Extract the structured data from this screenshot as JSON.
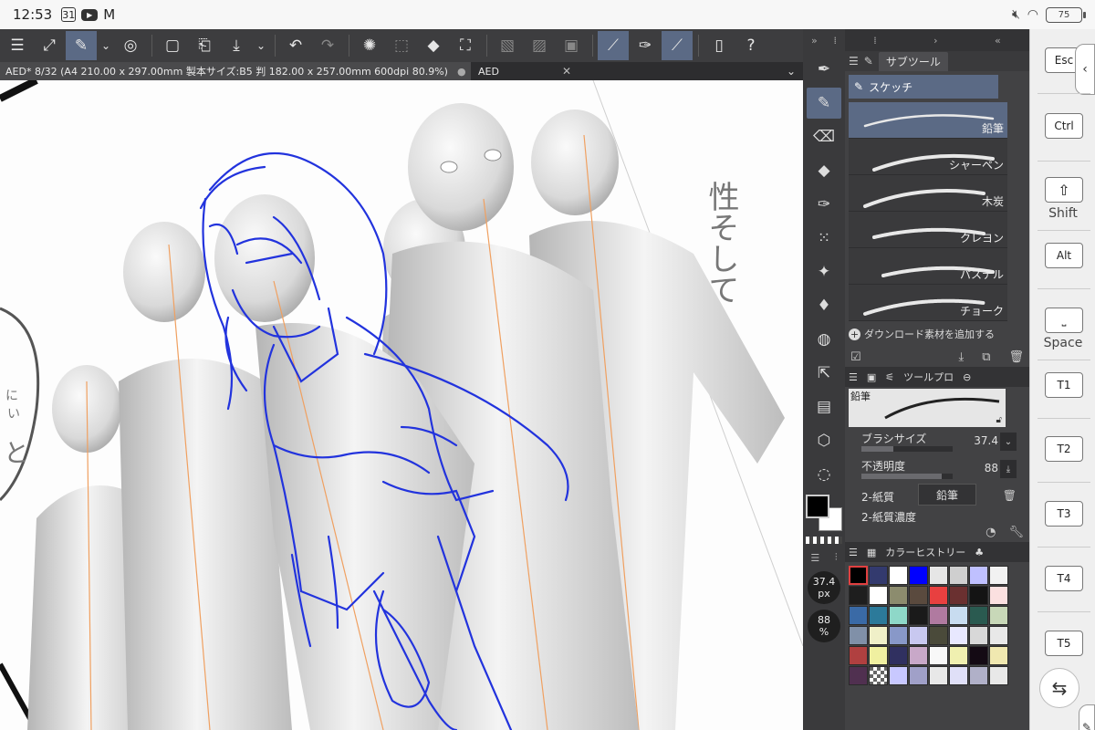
{
  "status_bar": {
    "time": "12:53",
    "calendar_day": "31",
    "battery": "75"
  },
  "toolbar": {
    "buttons": [
      {
        "name": "menu-icon",
        "glyph": "☰"
      },
      {
        "name": "fullscreen-icon",
        "glyph": "⤢"
      },
      {
        "name": "quick-access-icon",
        "glyph": "✎"
      },
      {
        "name": "dropdown-chevron-icon",
        "glyph": "⌄"
      },
      {
        "name": "companion-icon",
        "glyph": "◎"
      },
      {
        "name": "new-canvas-icon",
        "glyph": "▢"
      },
      {
        "name": "open-folder-icon",
        "glyph": "⎗"
      },
      {
        "name": "save-icon",
        "glyph": "⤓"
      },
      {
        "name": "save-dropdown-icon",
        "glyph": "⌄"
      },
      {
        "name": "undo-icon",
        "glyph": "↶"
      },
      {
        "name": "redo-icon",
        "glyph": "↷"
      },
      {
        "name": "loading-icon",
        "glyph": "✺"
      },
      {
        "name": "selection-icon",
        "glyph": "⬚"
      },
      {
        "name": "fill-icon",
        "glyph": "◆"
      },
      {
        "name": "transform-icon",
        "glyph": "⛶"
      },
      {
        "name": "clear-outside-icon",
        "glyph": "▧"
      },
      {
        "name": "clear-selection-icon",
        "glyph": "▨"
      },
      {
        "name": "select-all-icon",
        "glyph": "▣"
      },
      {
        "name": "ruler-snap-icon",
        "glyph": "⟋"
      },
      {
        "name": "brush-icon",
        "glyph": "✑"
      },
      {
        "name": "perspective-snap-icon",
        "glyph": "⟋"
      },
      {
        "name": "smartphone-icon",
        "glyph": "▯"
      },
      {
        "name": "help-icon",
        "glyph": "?"
      }
    ]
  },
  "tabs": {
    "main": "AED* 8/32 (A4 210.00 x 297.00mm 製本サイズ:B5 判 182.00 x 257.00mm 600dpi 80.9%)",
    "dot": "●",
    "second": "AED",
    "close": "✕",
    "chevron": "⌄"
  },
  "canvas": {
    "vertical_text": "性そして",
    "side_text_1": "い",
    "side_text_2": "と",
    "side_text_3": "に"
  },
  "sub_tool": {
    "header": "サブツール",
    "group": "スケッチ",
    "brushes": [
      "鉛筆",
      "シャーペン",
      "木炭",
      "クレヨン",
      "パステル",
      "チョーク"
    ],
    "add_material": "ダウンロード素材を追加する",
    "plus": "+"
  },
  "tool_property": {
    "header": "ツールプロ",
    "preview_name": "鉛筆",
    "brush_size_label": "ブラシサイズ",
    "brush_size_value": "37.4",
    "brush_size_fraction": 0.35,
    "opacity_label": "不透明度",
    "opacity_value": "88",
    "opacity_fraction": 0.88,
    "paper_label": "2-紙質",
    "paper_value": "鉛筆",
    "paper_density_label": "2-紙質濃度"
  },
  "color_history": {
    "header": "カラーヒストリー",
    "swatches": [
      "#000000",
      "#333a6e",
      "#ffffff",
      "#0000ff",
      "#e6e6e6",
      "#cfcfcf",
      "#bfc0ff",
      "#f2f2f2",
      "#1e1e1e",
      "#ffffff",
      "#8c8c6e",
      "#5a4a3e",
      "#e84040",
      "#6a3030",
      "#141414",
      "#fbe0e0",
      "#3a6aa6",
      "#2c7a9a",
      "#8ed8c8",
      "#1a1a1a",
      "#b07aa0",
      "#c8dcf0",
      "#2a5a50",
      "#c8d8b8",
      "#8090a8",
      "#f0f0c8",
      "#8898c8",
      "#c8c8f0",
      "#4a4a3a",
      "#e8e8ff",
      "#d8d8d8",
      "#e8e8e8",
      "#b04040",
      "#f0f0a0",
      "#303060",
      "#c8a8c8",
      "#f8f8f8",
      "#f0f0b0",
      "#140a14",
      "#f0e8b0",
      "#503050",
      "#checker",
      "#c8c8ff",
      "#a0a0c8",
      "#e8e8e8",
      "#e0e0f8",
      "#b0b0c8",
      "#e8e8e8"
    ]
  },
  "side_values": {
    "brush_px_value": "37.4",
    "brush_px_unit": "px",
    "opacity_value": "88",
    "opacity_unit": "%"
  },
  "shortcuts": {
    "esc": "Esc",
    "ctrl": "Ctrl",
    "shift_key": "⇧",
    "shift_label": "Shift",
    "alt": "Alt",
    "space_label": "Space",
    "t1": "T1",
    "t2": "T2",
    "t3": "T3",
    "t4": "T4",
    "t5": "T5"
  }
}
